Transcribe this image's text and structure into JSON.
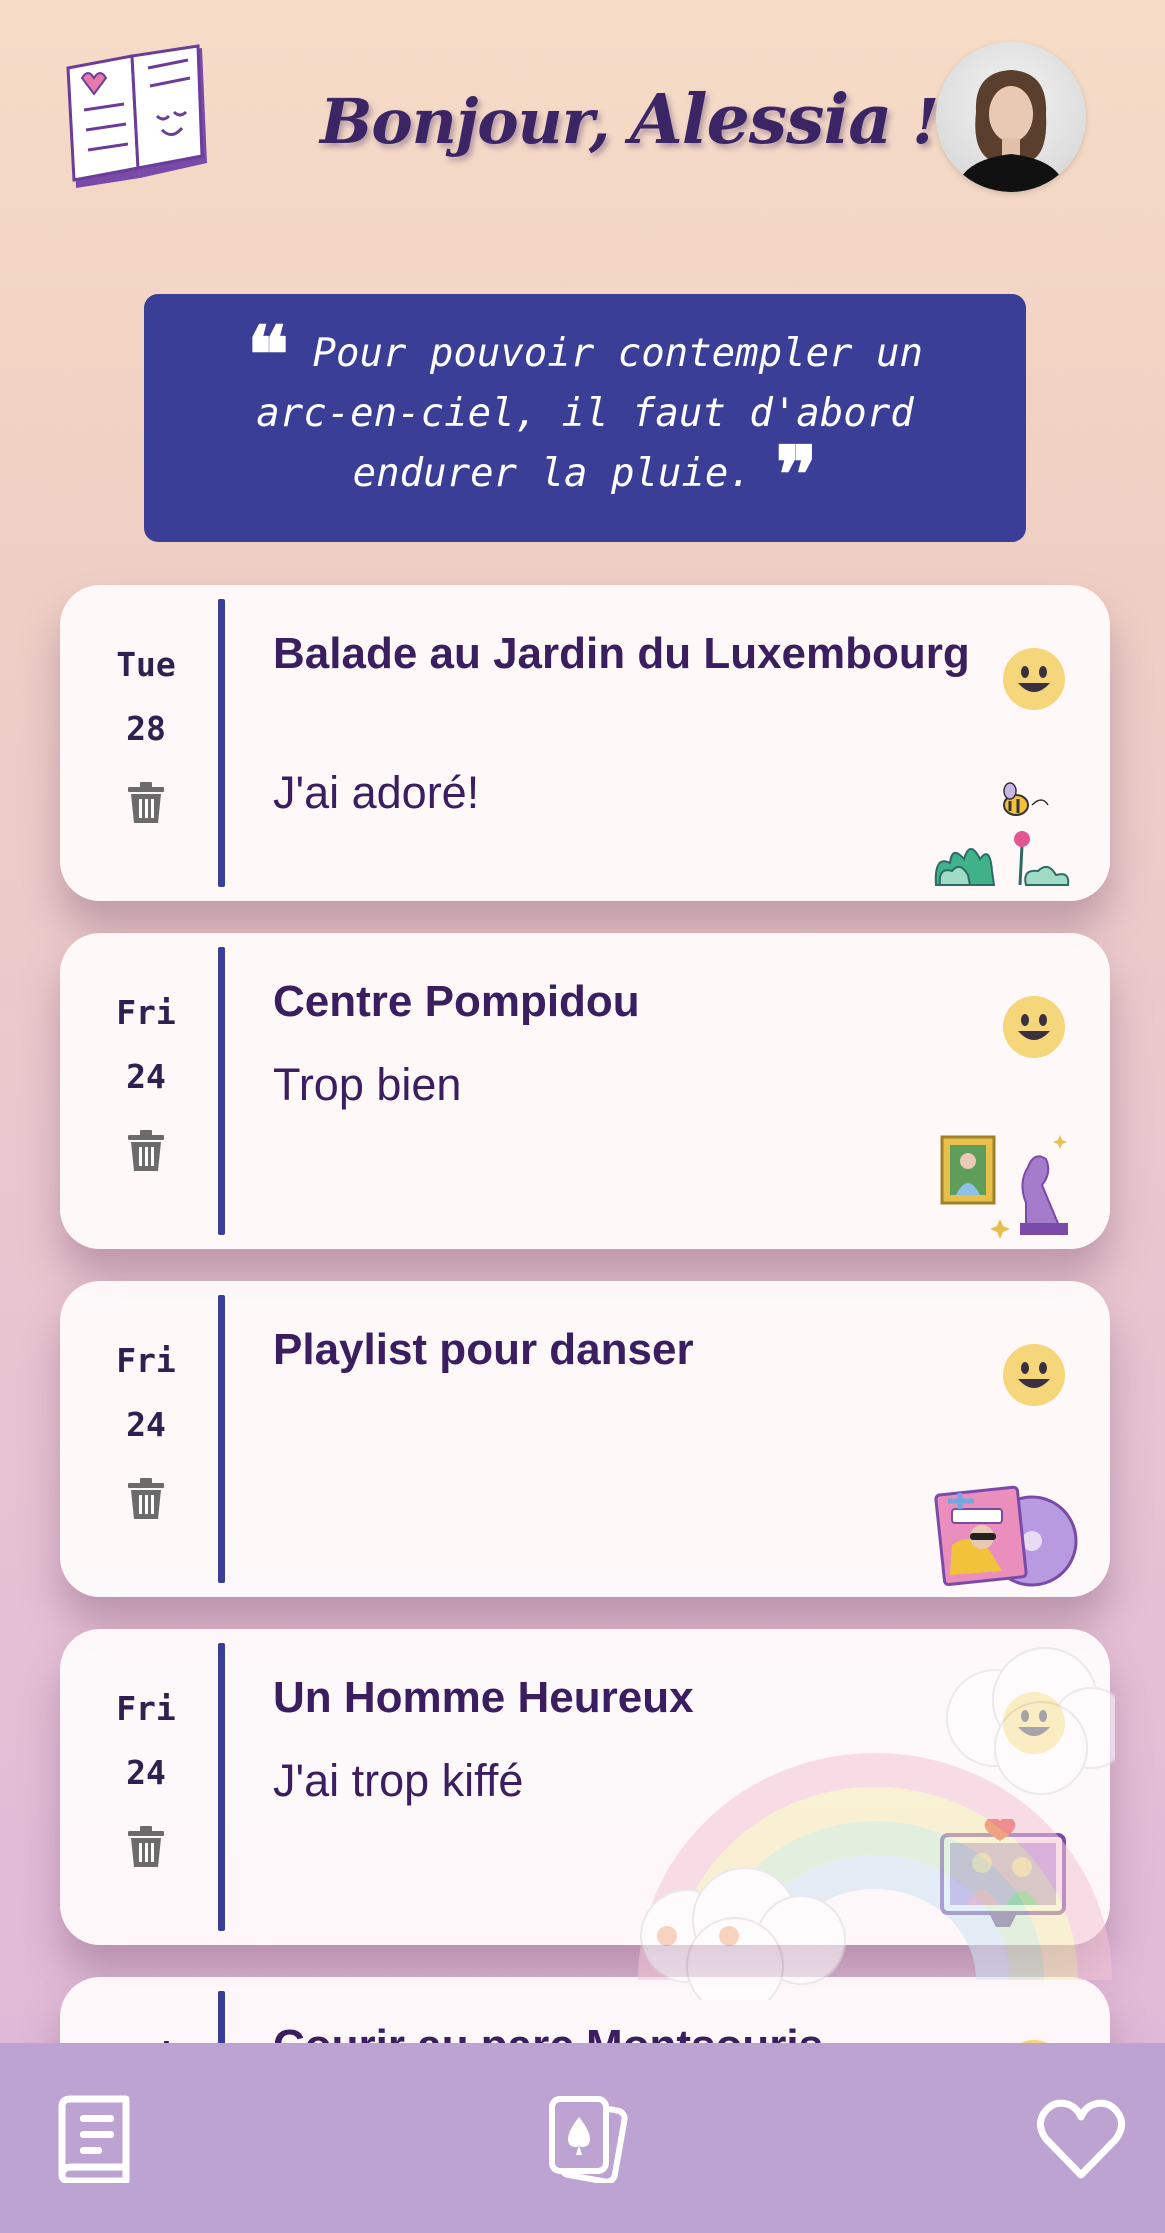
{
  "header": {
    "greeting_prefix": "Bonjour, ",
    "user_name": "Alessia",
    "greeting_suffix": " !",
    "book_icon": "open-book-icon",
    "avatar_icon": "user-avatar"
  },
  "quote": {
    "text": "Pour pouvoir contempler un arc-en-ciel, il faut d'abord endurer la pluie.",
    "open_mark": "❝",
    "close_mark": "❞"
  },
  "entries": [
    {
      "day": "Tue",
      "date": "28",
      "title": "Balade au Jardin du Luxembourg",
      "note": "J'ai adoré!",
      "mood_icon": "happy-face-icon",
      "sticker_icon": "garden-bee-sticker",
      "delete_icon": "trash-icon"
    },
    {
      "day": "Fri",
      "date": "24",
      "title": "Centre Pompidou",
      "note": "Trop bien",
      "mood_icon": "happy-face-icon",
      "sticker_icon": "museum-art-sticker",
      "delete_icon": "trash-icon"
    },
    {
      "day": "Fri",
      "date": "24",
      "title": "Playlist pour danser",
      "note": "",
      "mood_icon": "happy-face-icon",
      "sticker_icon": "vinyl-record-sticker",
      "delete_icon": "trash-icon"
    },
    {
      "day": "Fri",
      "date": "24",
      "title": "Un Homme Heureux",
      "note": "J'ai trop kiffé",
      "mood_icon": "happy-face-icon",
      "sticker_icon": "movie-screen-sticker",
      "delete_icon": "trash-icon"
    },
    {
      "day": "Fri",
      "date": "",
      "title": "Courir au parc Montsouris",
      "note": "",
      "mood_icon": "happy-face-icon",
      "sticker_icon": "",
      "delete_icon": "trash-icon"
    }
  ],
  "nav": {
    "journal_icon": "journal-book-icon",
    "cards_icon": "playing-cards-icon",
    "favorites_icon": "heart-icon"
  },
  "colors": {
    "accent": "#3b3e97",
    "title_text": "#3a1e60",
    "nav_bg": "#bca3d1",
    "mood_yellow": "#f5d67a"
  }
}
